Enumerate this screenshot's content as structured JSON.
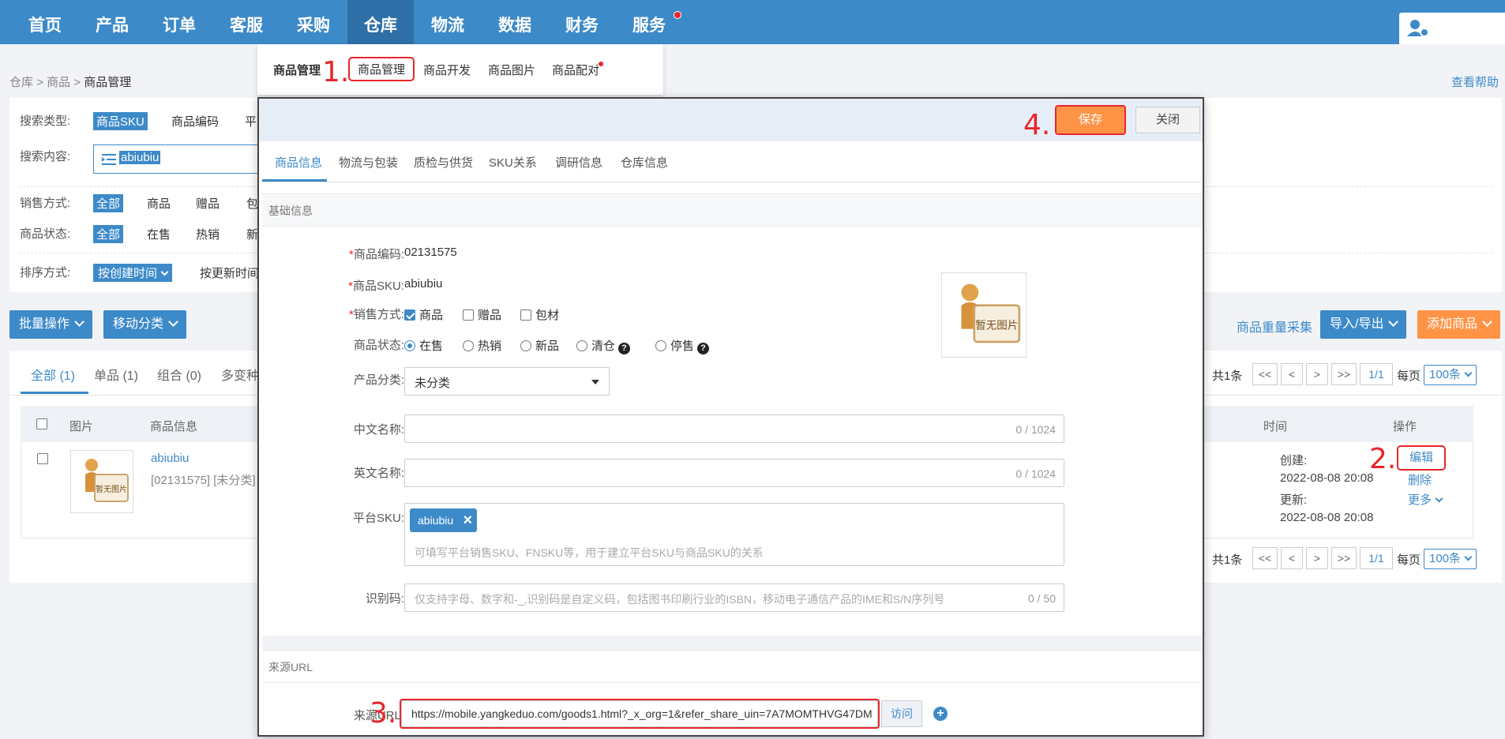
{
  "nav": {
    "items": [
      "首页",
      "产品",
      "订单",
      "客服",
      "采购",
      "仓库",
      "物流",
      "数据",
      "财务",
      "服务"
    ],
    "active_index": 5
  },
  "submenu": {
    "items": [
      "商品管理",
      "商品管理",
      "商品开发",
      "商品图片",
      "商品配对"
    ]
  },
  "breadcrumb": {
    "root": "仓库",
    "sep": ">",
    "mid": "商品",
    "current": "商品管理"
  },
  "help_link": "查看帮助",
  "filters": {
    "search_type_label": "搜索类型:",
    "search_type_options": [
      "商品SKU",
      "商品编码",
      "平"
    ],
    "search_content_label": "搜索内容:",
    "search_value": "abiubiu",
    "sale_mode_label": "销售方式:",
    "sale_mode_options": [
      "全部",
      "商品",
      "赠品",
      "包"
    ],
    "status_label": "商品状态:",
    "status_options": [
      "全部",
      "在售",
      "热销",
      "新"
    ],
    "sort_label": "排序方式:",
    "sort_selected": "按创建时间",
    "sort_other": "按更新时间"
  },
  "actions": {
    "batch": "批量操作",
    "move": "移动分类",
    "weight": "商品重量采集",
    "import_export": "导入/导出",
    "add": "添加商品"
  },
  "list": {
    "tabs": [
      "全部 (1)",
      "单品 (1)",
      "组合 (0)",
      "多变种"
    ],
    "columns": {
      "image": "图片",
      "info": "商品信息",
      "time": "时间",
      "ops": "操作"
    },
    "row": {
      "name": "abiubiu",
      "sub": "[02131575] [未分类]",
      "created_label": "创建:",
      "created": "2022-08-08 20:08",
      "updated_label": "更新:",
      "updated": "2022-08-08 20:08",
      "edit": "编辑",
      "delete": "删除",
      "more": "更多"
    },
    "pager": {
      "total": "共1条",
      "first": "<<",
      "prev": "<",
      "next": ">",
      "last": ">>",
      "page": "1/1",
      "per_label": "每页",
      "per_value": "100条"
    }
  },
  "no_image_text": "暂无图片",
  "modal": {
    "save": "保存",
    "close": "关闭",
    "tabs": [
      "商品信息",
      "物流与包装",
      "质检与供货",
      "SKU关系",
      "调研信息",
      "仓库信息"
    ],
    "section_basic": "基础信息",
    "code_label": "商品编码:",
    "code_value": "02131575",
    "sku_label": "商品SKU:",
    "sku_value": "abiubiu",
    "sale_label": "销售方式:",
    "sale_options": [
      "商品",
      "赠品",
      "包材"
    ],
    "status_label": "商品状态:",
    "status_options": [
      "在售",
      "热销",
      "新品",
      "清仓",
      "停售"
    ],
    "category_label": "产品分类:",
    "category_value": "未分类",
    "cn_name_label": "中文名称:",
    "cn_name_counter": "0 / 1024",
    "en_name_label": "英文名称:",
    "en_name_counter": "0 / 1024",
    "platform_sku_label": "平台SKU:",
    "platform_sku_tag": "abiubiu",
    "platform_sku_hint": "可填写平台销售SKU、FNSKU等，用于建立平台SKU与商品SKU的关系",
    "idcode_label": "识别码:",
    "idcode_placeholder": "仅支持字母、数字和-_,识别码是自定义码，包括图书印刷行业的ISBN，移动电子通信产品的IME和S/N序列号",
    "idcode_counter": "0 / 50",
    "section_url": "来源URL",
    "url_label": "来源URL:",
    "url_value": "https://mobile.yangkeduo.com/goods1.html?_x_org=1&refer_share_uin=7A7MOMTHVG47DM",
    "visit": "访问"
  },
  "steps": [
    "1.",
    "2.",
    "3.",
    "4."
  ],
  "colors": {
    "primary": "#3d8ac9",
    "accent": "#ff9447",
    "annotation": "#e8262c"
  }
}
